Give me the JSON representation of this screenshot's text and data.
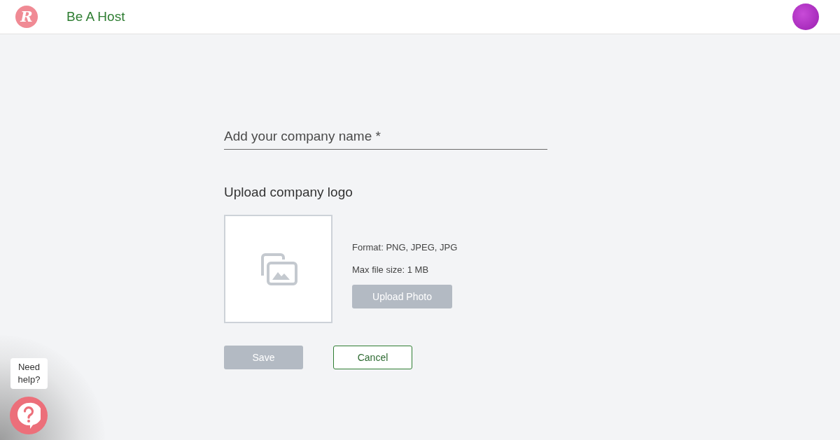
{
  "header": {
    "logo_letter": "R",
    "title": "Be A Host"
  },
  "form": {
    "company_name": {
      "placeholder": "Add your company name *"
    },
    "logo_section": {
      "heading": "Upload company logo",
      "hints": [
        "Format: PNG, JPEG, JPG",
        "Max file size: 1 MB"
      ],
      "upload_button": {
        "label": "Upload Photo",
        "disabled": true
      }
    },
    "buttons": [
      {
        "label": "Save",
        "kind": "primary",
        "disabled": true
      },
      {
        "label": "Cancel",
        "kind": "outline",
        "disabled": false
      }
    ]
  },
  "help": {
    "text": "Need help?"
  }
}
